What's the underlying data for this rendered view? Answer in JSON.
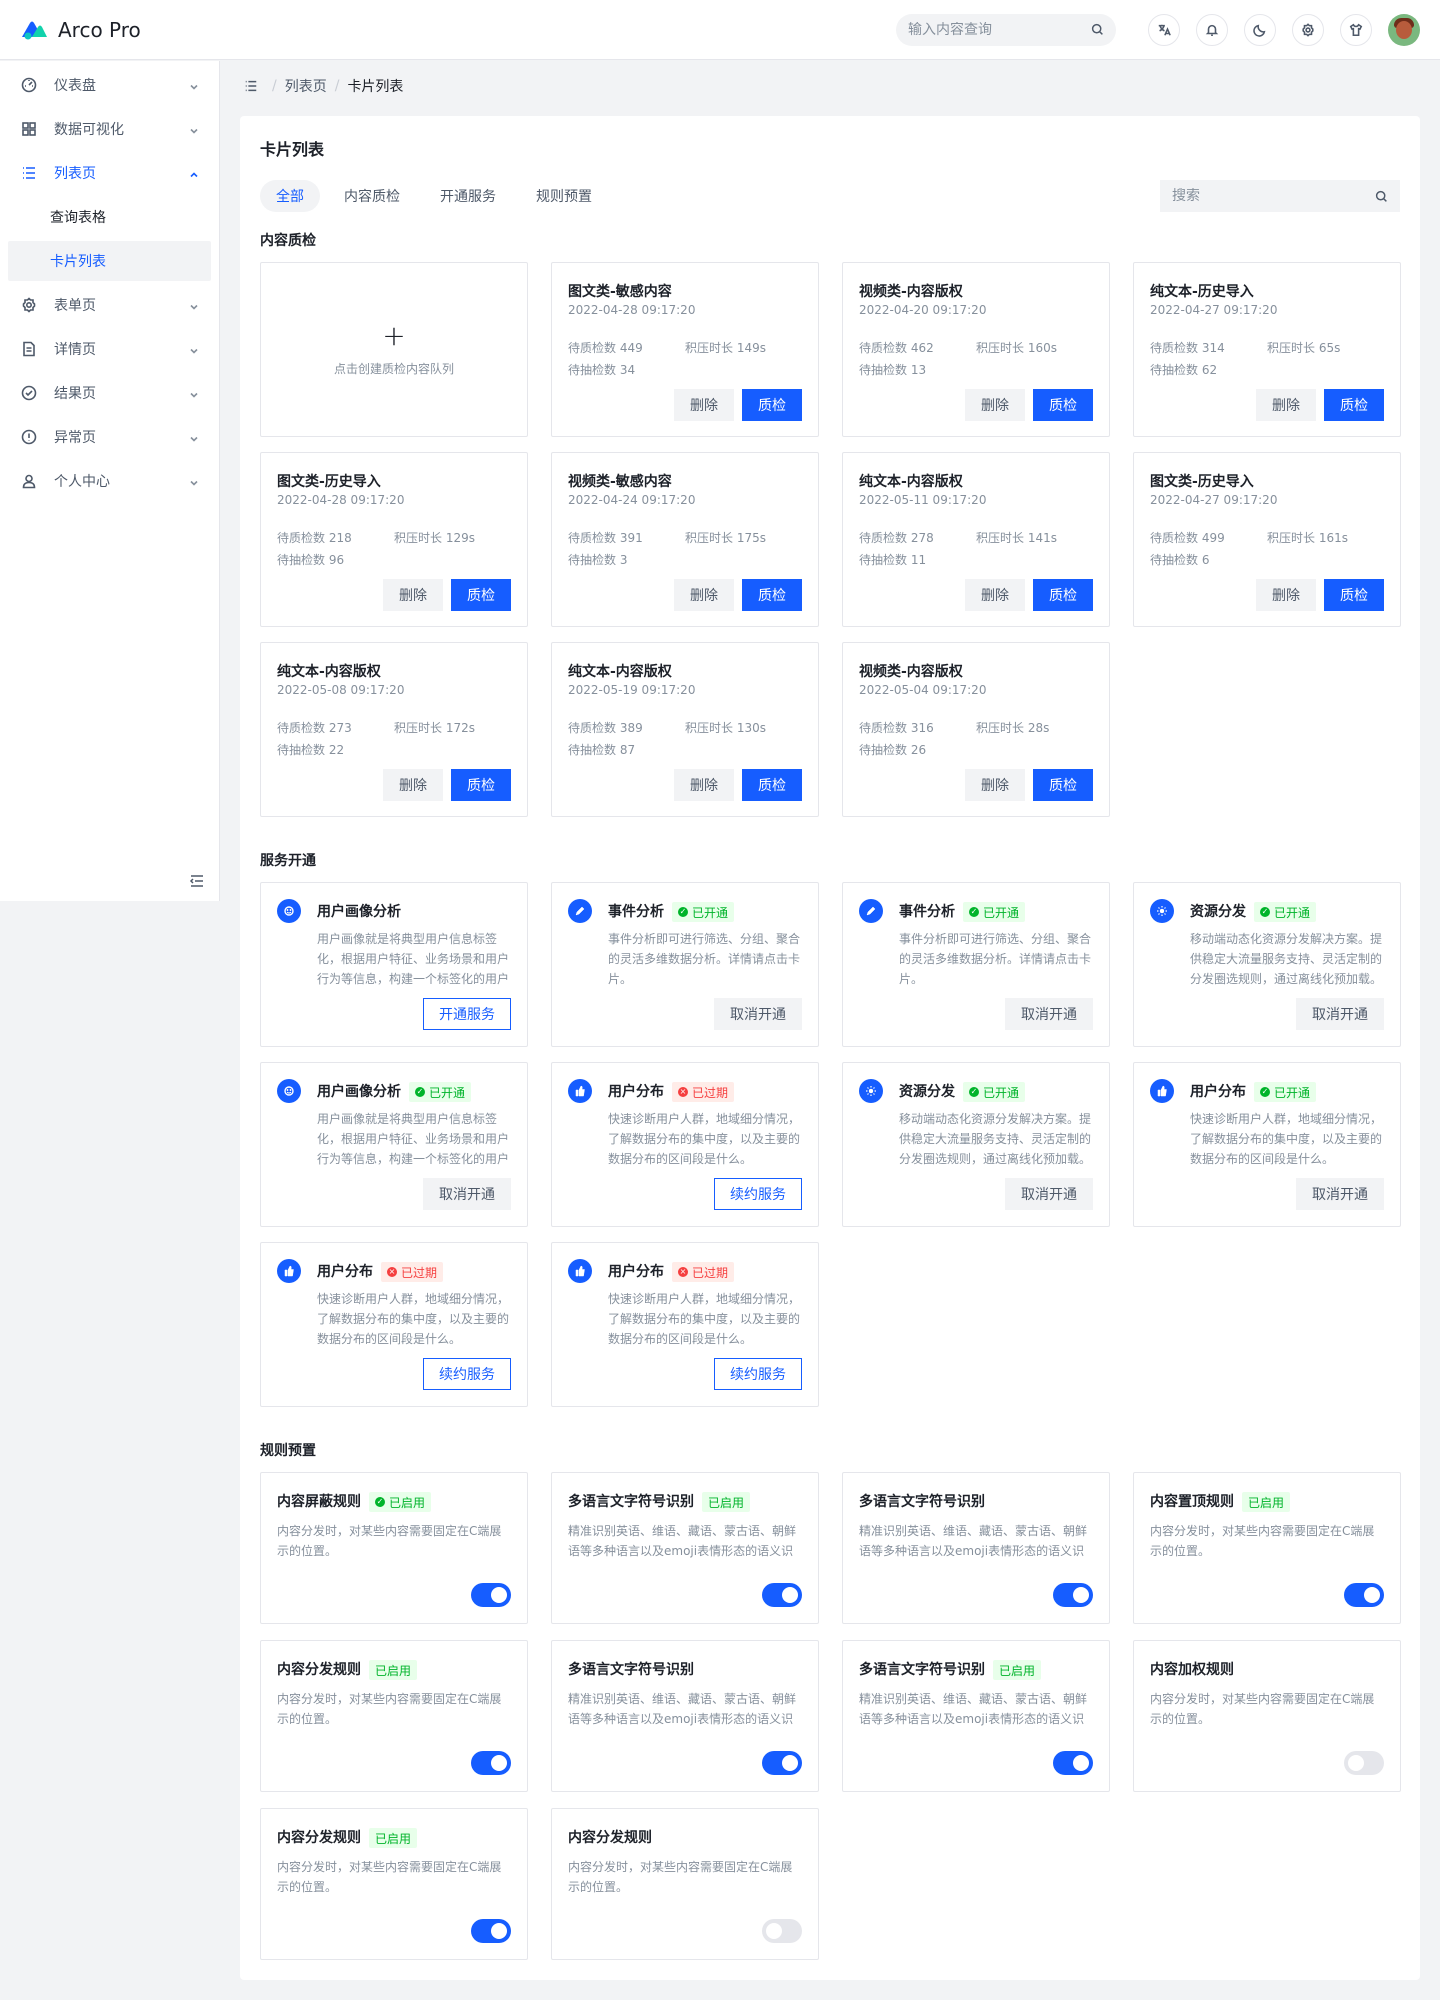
{
  "app": {
    "title": "Arco Pro"
  },
  "header": {
    "search_placeholder": "输入内容查询"
  },
  "sidebar": {
    "items": [
      {
        "label": "仪表盘"
      },
      {
        "label": "数据可视化"
      },
      {
        "label": "列表页"
      },
      {
        "label": "查询表格"
      },
      {
        "label": "卡片列表"
      },
      {
        "label": "表单页"
      },
      {
        "label": "详情页"
      },
      {
        "label": "结果页"
      },
      {
        "label": "异常页"
      },
      {
        "label": "个人中心"
      }
    ]
  },
  "breadcrumb": {
    "items": [
      "列表页",
      "卡片列表"
    ]
  },
  "page": {
    "title": "卡片列表",
    "tabs": [
      "全部",
      "内容质检",
      "开通服务",
      "规则预置"
    ],
    "search_placeholder": "搜索"
  },
  "quality": {
    "section_title": "内容质检",
    "add_text": "点击创建质检内容队列",
    "pending_label": "待质检数",
    "backlog_label": "积压时长",
    "sampling_label": "待抽检数",
    "delete_label": "删除",
    "inspect_label": "质检",
    "cards": [
      {
        "title": "图文类-敏感内容",
        "time": "2022-04-28 09:17:20",
        "pending": "449",
        "backlog": "149s",
        "sampling": "34"
      },
      {
        "title": "视频类-内容版权",
        "time": "2022-04-20 09:17:20",
        "pending": "462",
        "backlog": "160s",
        "sampling": "13"
      },
      {
        "title": "纯文本-历史导入",
        "time": "2022-04-27 09:17:20",
        "pending": "314",
        "backlog": "65s",
        "sampling": "62"
      },
      {
        "title": "图文类-历史导入",
        "time": "2022-04-28 09:17:20",
        "pending": "218",
        "backlog": "129s",
        "sampling": "96"
      },
      {
        "title": "视频类-敏感内容",
        "time": "2022-04-24 09:17:20",
        "pending": "391",
        "backlog": "175s",
        "sampling": "3"
      },
      {
        "title": "纯文本-内容版权",
        "time": "2022-05-11 09:17:20",
        "pending": "278",
        "backlog": "141s",
        "sampling": "11"
      },
      {
        "title": "图文类-历史导入",
        "time": "2022-04-27 09:17:20",
        "pending": "499",
        "backlog": "161s",
        "sampling": "6"
      },
      {
        "title": "纯文本-内容版权",
        "time": "2022-05-08 09:17:20",
        "pending": "273",
        "backlog": "172s",
        "sampling": "22"
      },
      {
        "title": "纯文本-内容版权",
        "time": "2022-05-19 09:17:20",
        "pending": "389",
        "backlog": "130s",
        "sampling": "87"
      },
      {
        "title": "视频类-内容版权",
        "time": "2022-05-04 09:17:20",
        "pending": "316",
        "backlog": "28s",
        "sampling": "26"
      }
    ]
  },
  "services": {
    "section_title": "服务开通",
    "cards": [
      {
        "title": "用户画像分析",
        "icon": "user-portrait-icon",
        "tag": "",
        "status": "",
        "desc": "用户画像就是将典型用户信息标签化，根据用户特征、业务场景和用户行为等信息，构建一个标签化的用户模型",
        "button": "开通服务",
        "button_style": "outline"
      },
      {
        "title": "事件分析",
        "icon": "edit-icon",
        "tag": "已开通",
        "status": "green",
        "desc": "事件分析即可进行筛选、分组、聚合的灵活多维数据分析。详情请点击卡片。",
        "button": "取消开通",
        "button_style": "grey"
      },
      {
        "title": "事件分析",
        "icon": "edit-icon",
        "tag": "已开通",
        "status": "green",
        "desc": "事件分析即可进行筛选、分组、聚合的灵活多维数据分析。详情请点击卡片。",
        "button": "取消开通",
        "button_style": "grey"
      },
      {
        "title": "资源分发",
        "icon": "sun-icon",
        "tag": "已开通",
        "status": "green",
        "desc": "移动端动态化资源分发解决方案。提供稳定大流量服务支持、灵活定制的分发圈选规则，通过离线化预加载。",
        "button": "取消开通",
        "button_style": "grey"
      },
      {
        "title": "用户画像分析",
        "icon": "user-portrait-icon",
        "tag": "已开通",
        "status": "green",
        "desc": "用户画像就是将典型用户信息标签化，根据用户特征、业务场景和用户行为等信息，构建一个标签化的用户模型",
        "button": "取消开通",
        "button_style": "grey"
      },
      {
        "title": "用户分布",
        "icon": "thumb-up-icon",
        "tag": "已过期",
        "status": "red",
        "desc": "快速诊断用户人群，地域细分情况，了解数据分布的集中度，以及主要的数据分布的区间段是什么。",
        "button": "续约服务",
        "button_style": "outline"
      },
      {
        "title": "资源分发",
        "icon": "sun-icon",
        "tag": "已开通",
        "status": "green",
        "desc": "移动端动态化资源分发解决方案。提供稳定大流量服务支持、灵活定制的分发圈选规则，通过离线化预加载。",
        "button": "取消开通",
        "button_style": "grey"
      },
      {
        "title": "用户分布",
        "icon": "thumb-up-icon",
        "tag": "已开通",
        "status": "green",
        "desc": "快速诊断用户人群，地域细分情况，了解数据分布的集中度，以及主要的数据分布的区间段是什么。",
        "button": "取消开通",
        "button_style": "grey"
      },
      {
        "title": "用户分布",
        "icon": "thumb-up-icon",
        "tag": "已过期",
        "status": "red",
        "desc": "快速诊断用户人群，地域细分情况，了解数据分布的集中度，以及主要的数据分布的区间段是什么。",
        "button": "续约服务",
        "button_style": "outline"
      },
      {
        "title": "用户分布",
        "icon": "thumb-up-icon",
        "tag": "已过期",
        "status": "red",
        "desc": "快速诊断用户人群，地域细分情况，了解数据分布的集中度，以及主要的数据分布的区间段是什么。",
        "button": "续约服务",
        "button_style": "outline"
      }
    ]
  },
  "rules": {
    "section_title": "规则预置",
    "cards": [
      {
        "title": "内容屏蔽规则",
        "tag": "已启用",
        "tag_dot": true,
        "desc": "内容分发时，对某些内容需要固定在C端展示的位置。",
        "enabled": true
      },
      {
        "title": "多语言文字符号识别",
        "tag": "已启用",
        "tag_dot": false,
        "desc": "精准识别英语、维语、藏语、蒙古语、朝鲜语等多种语言以及emoji表情形态的语义识别。",
        "enabled": true
      },
      {
        "title": "多语言文字符号识别",
        "tag": "",
        "tag_dot": false,
        "desc": "精准识别英语、维语、藏语、蒙古语、朝鲜语等多种语言以及emoji表情形态的语义识别。",
        "enabled": true
      },
      {
        "title": "内容置顶规则",
        "tag": "已启用",
        "tag_dot": false,
        "desc": "内容分发时，对某些内容需要固定在C端展示的位置。",
        "enabled": true
      },
      {
        "title": "内容分发规则",
        "tag": "已启用",
        "tag_dot": false,
        "desc": "内容分发时，对某些内容需要固定在C端展示的位置。",
        "enabled": true
      },
      {
        "title": "多语言文字符号识别",
        "tag": "",
        "tag_dot": false,
        "desc": "精准识别英语、维语、藏语、蒙古语、朝鲜语等多种语言以及emoji表情形态的语义识别。",
        "enabled": true
      },
      {
        "title": "多语言文字符号识别",
        "tag": "已启用",
        "tag_dot": false,
        "desc": "精准识别英语、维语、藏语、蒙古语、朝鲜语等多种语言以及emoji表情形态的语义识别。",
        "enabled": true
      },
      {
        "title": "内容加权规则",
        "tag": "",
        "tag_dot": false,
        "desc": "内容分发时，对某些内容需要固定在C端展示的位置。",
        "enabled": false
      },
      {
        "title": "内容分发规则",
        "tag": "已启用",
        "tag_dot": false,
        "desc": "内容分发时，对某些内容需要固定在C端展示的位置。",
        "enabled": true
      },
      {
        "title": "内容分发规则",
        "tag": "",
        "tag_dot": false,
        "desc": "内容分发时，对某些内容需要固定在C端展示的位置。",
        "enabled": false
      }
    ]
  },
  "colors": {
    "primary": "#165dff",
    "success": "#00b42a",
    "danger": "#f53f3f"
  }
}
